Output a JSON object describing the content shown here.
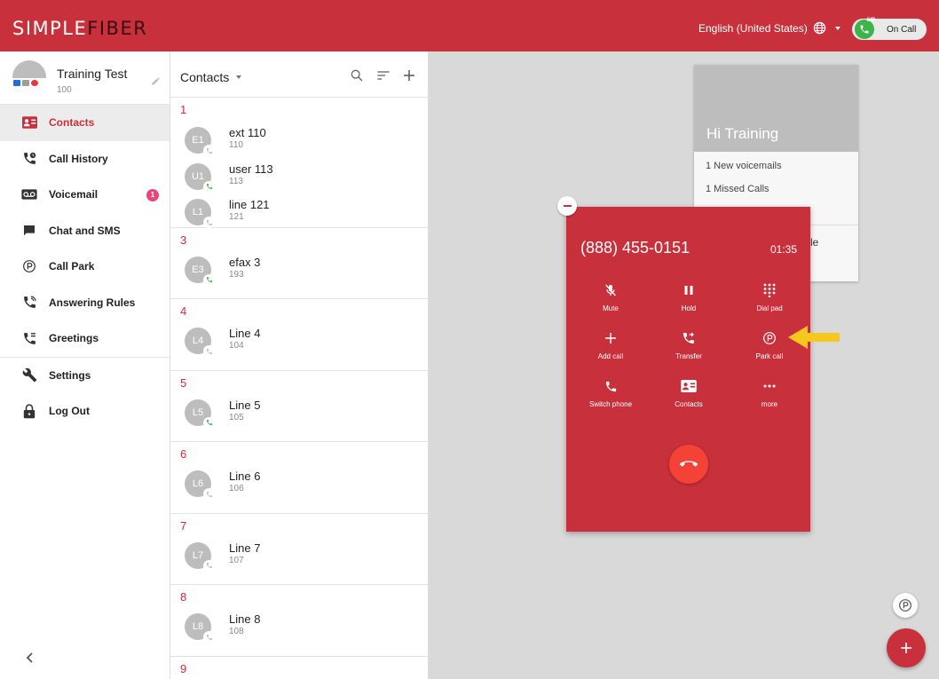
{
  "header": {
    "logo_light": "SIMPLE",
    "logo_dark": "FIBER",
    "language": "English (United States)",
    "status_label": "On Call",
    "status_badge": "SIP"
  },
  "sidebar": {
    "user_name": "Training Test",
    "user_ext": "100",
    "items": [
      {
        "label": "Contacts",
        "icon": "contacts-icon",
        "active": true
      },
      {
        "label": "Call History",
        "icon": "call-history-icon"
      },
      {
        "label": "Voicemail",
        "icon": "voicemail-icon",
        "badge": "1"
      },
      {
        "label": "Chat and SMS",
        "icon": "chat-icon"
      },
      {
        "label": "Call Park",
        "icon": "park-icon"
      },
      {
        "label": "Answering Rules",
        "icon": "answering-rules-icon"
      },
      {
        "label": "Greetings",
        "icon": "greetings-icon"
      },
      {
        "label": "Settings",
        "icon": "wrench-icon"
      },
      {
        "label": "Log Out",
        "icon": "lock-icon"
      }
    ]
  },
  "contacts": {
    "title": "Contacts",
    "groups": [
      {
        "letter": "1",
        "rows": [
          {
            "initials": "E1",
            "name": "ext 110",
            "ext": "110",
            "presence": "grey"
          },
          {
            "initials": "U1",
            "name": "user 113",
            "ext": "113",
            "presence": "green"
          },
          {
            "initials": "L1",
            "name": "line 121",
            "ext": "121",
            "presence": "grey"
          }
        ]
      },
      {
        "letter": "3",
        "rows": [
          {
            "initials": "E3",
            "name": "efax 3",
            "ext": "193",
            "presence": "green"
          }
        ]
      },
      {
        "letter": "4",
        "rows": [
          {
            "initials": "L4",
            "name": "Line 4",
            "ext": "104",
            "presence": "grey"
          }
        ]
      },
      {
        "letter": "5",
        "rows": [
          {
            "initials": "L5",
            "name": "Line 5",
            "ext": "105",
            "presence": "green"
          }
        ]
      },
      {
        "letter": "6",
        "rows": [
          {
            "initials": "L6",
            "name": "Line 6",
            "ext": "106",
            "presence": "grey"
          }
        ]
      },
      {
        "letter": "7",
        "rows": [
          {
            "initials": "L7",
            "name": "Line 7",
            "ext": "107",
            "presence": "grey"
          }
        ]
      },
      {
        "letter": "8",
        "rows": [
          {
            "initials": "L8",
            "name": "Line 8",
            "ext": "108",
            "presence": "grey"
          }
        ]
      },
      {
        "letter": "9",
        "rows": []
      }
    ]
  },
  "welcome": {
    "greeting": "Hi Training",
    "voicemails": "1 New voicemails",
    "missed": "1 Missed Calls",
    "tail": "le"
  },
  "call": {
    "number": "(888) 455-0151",
    "timer": "01:35",
    "buttons": [
      {
        "label": "Mute",
        "icon": "mic-off-icon"
      },
      {
        "label": "Hold",
        "icon": "pause-icon"
      },
      {
        "label": "Dial pad",
        "icon": "dialpad-icon"
      },
      {
        "label": "Add call",
        "icon": "plus-icon"
      },
      {
        "label": "Transfer",
        "icon": "transfer-icon"
      },
      {
        "label": "Park call",
        "icon": "park-icon"
      },
      {
        "label": "Switch phone",
        "icon": "phone-icon"
      },
      {
        "label": "Contacts",
        "icon": "contacts-icon"
      },
      {
        "label": "more",
        "icon": "more-icon"
      }
    ]
  },
  "colors": {
    "brand": "#c8303b",
    "hangup": "#f44336",
    "arrow": "#f6c81b",
    "presence_green": "#3bb54a"
  }
}
